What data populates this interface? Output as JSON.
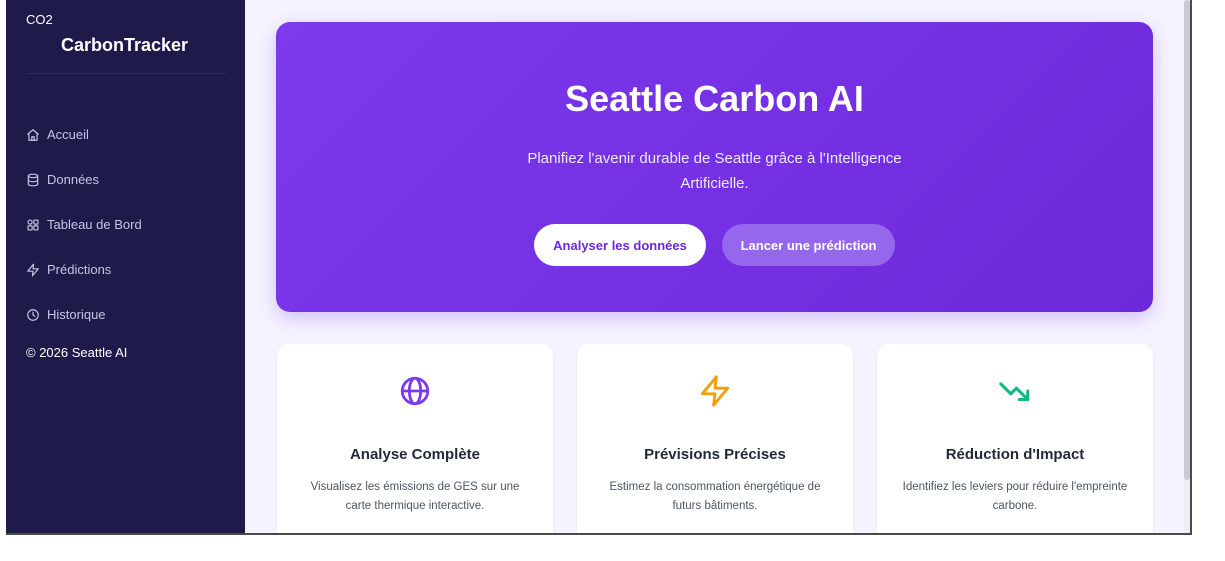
{
  "sidebar": {
    "brand_small": "CO2",
    "brand_main": "CarbonTracker",
    "items": [
      {
        "label": "Accueil",
        "icon": "home-icon"
      },
      {
        "label": "Données",
        "icon": "database-icon"
      },
      {
        "label": "Tableau de Bord",
        "icon": "grid-icon"
      },
      {
        "label": "Prédictions",
        "icon": "zap-icon"
      },
      {
        "label": "Historique",
        "icon": "clock-icon"
      }
    ],
    "footer": "© 2026 Seattle AI"
  },
  "hero": {
    "title": "Seattle Carbon AI",
    "subtitle": "Planifiez l'avenir durable de Seattle grâce à l'Intelligence Artificielle.",
    "primary_button": "Analyser les données",
    "secondary_button": "Lancer une prédiction"
  },
  "features": [
    {
      "title": "Analyse Complète",
      "desc": "Visualisez les émissions de GES sur une carte thermique interactive.",
      "icon": "globe-icon",
      "color": "#7c3aed"
    },
    {
      "title": "Prévisions Précises",
      "desc": "Estimez la consommation énergétique de futurs bâtiments.",
      "icon": "zap-icon",
      "color": "#f59e0b"
    },
    {
      "title": "Réduction d'Impact",
      "desc": "Identifiez les leviers pour réduire l'empreinte carbone.",
      "icon": "trending-down-icon",
      "color": "#10b981"
    }
  ],
  "colors": {
    "sidebar_bg": "#1e1b4b",
    "accent": "#7c3aed",
    "page_bg": "#f5f3ff"
  }
}
